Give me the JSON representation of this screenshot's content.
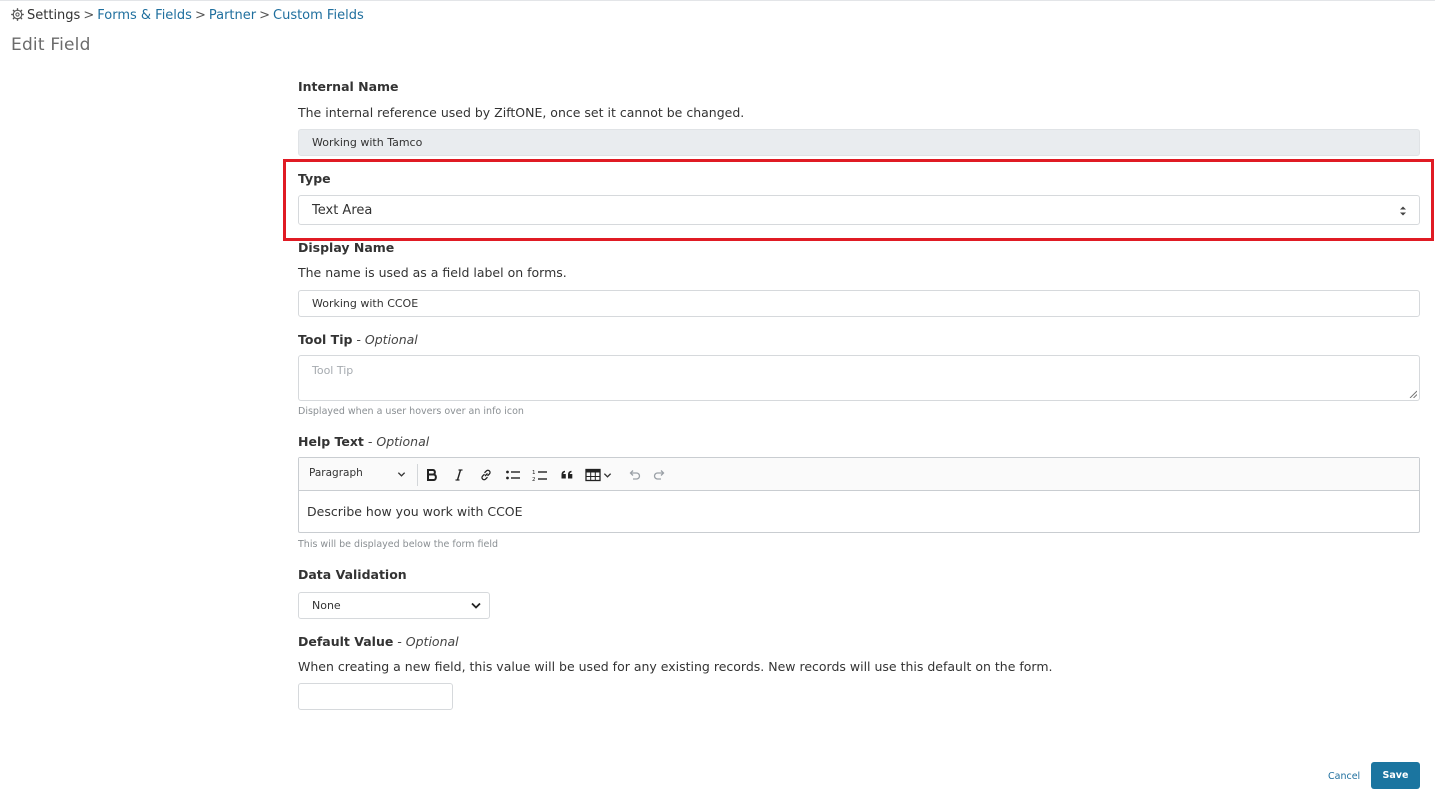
{
  "breadcrumb": {
    "root": "Settings",
    "items": [
      "Forms & Fields",
      "Partner",
      "Custom Fields"
    ],
    "separator": ">"
  },
  "page_title": "Edit Field",
  "internal_name": {
    "label": "Internal Name",
    "description": "The internal reference used by ZiftONE, once set it cannot be changed.",
    "value": "Working with Tamco"
  },
  "type": {
    "label": "Type",
    "value": "Text Area"
  },
  "display_name": {
    "label": "Display Name",
    "description": "The name is used as a field label on forms.",
    "value": "Working with CCOE"
  },
  "tool_tip": {
    "label": "Tool Tip",
    "optional": " - Optional",
    "placeholder": "Tool Tip",
    "hint": "Displayed when a user hovers over an info icon"
  },
  "help_text": {
    "label": "Help Text",
    "optional": " - Optional",
    "format": "Paragraph",
    "content": "Describe how you work with CCOE",
    "hint": "This will be displayed below the form field"
  },
  "data_validation": {
    "label": "Data Validation",
    "value": "None"
  },
  "default_value": {
    "label": "Default Value",
    "optional": " - Optional",
    "description": "When creating a new field, this value will be used for any existing records. New records will use this default on the form.",
    "value": ""
  },
  "actions": {
    "cancel": "Cancel",
    "save": "Save"
  },
  "colors": {
    "link": "#1f6f9e",
    "primary_button": "#1b75a0",
    "highlight": "#e01b24"
  },
  "icons": {
    "breadcrumb": "gear-icon",
    "toolbar": [
      "bold-icon",
      "italic-icon",
      "link-icon",
      "bulleted-list-icon",
      "numbered-list-icon",
      "blockquote-icon",
      "table-icon",
      "undo-icon",
      "redo-icon"
    ]
  }
}
